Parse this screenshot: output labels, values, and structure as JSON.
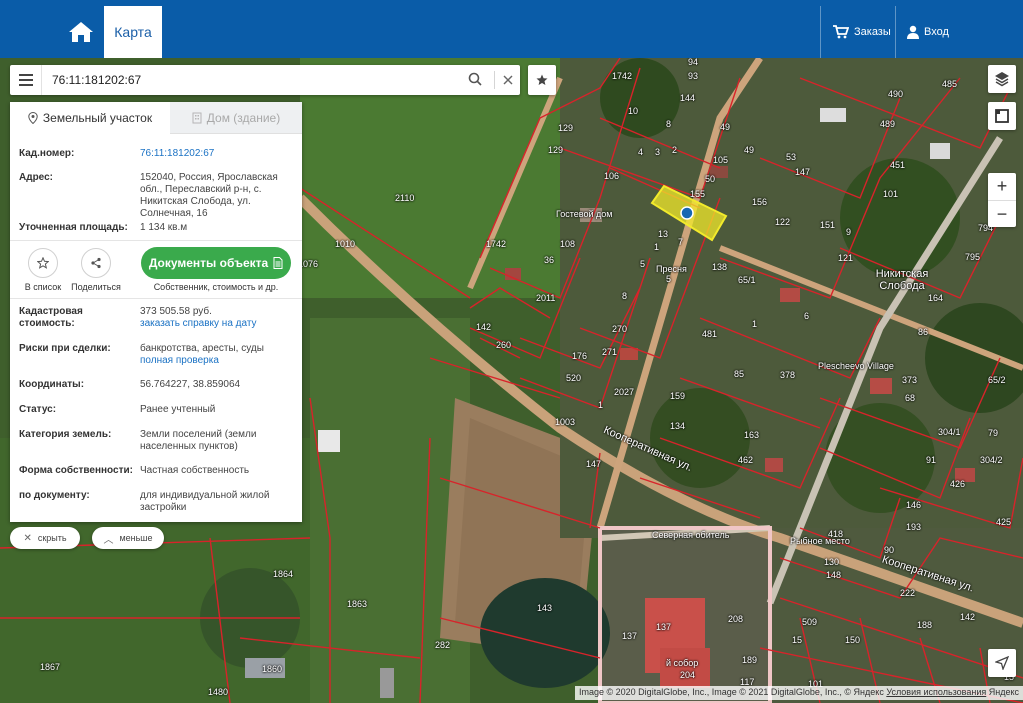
{
  "header": {
    "tab_map": "Карта",
    "orders": "Заказы",
    "login": "Вход"
  },
  "search": {
    "query": "76:11:181202:67"
  },
  "panel": {
    "tabs": [
      {
        "label": "Земельный участок",
        "active": true
      },
      {
        "label": "Дом (здание)",
        "active": false
      }
    ],
    "cadastral_label": "Кад.номер:",
    "cadastral_value": "76:11:181202:67",
    "address_label": "Адрес:",
    "address_value": "152040, Россия, Ярославская обл., Переславский р-н, с. Никитская Слобода, ул. Солнечная, 16",
    "area_label": "Уточненная площадь:",
    "area_value": "1 134 кв.м",
    "add_list": "В список",
    "share": "Поделиться",
    "docs_button": "Документы объекта",
    "docs_sub": "Собственник, стоимость и др.",
    "cost_label_1": "Кадастровая",
    "cost_label_2": "стоимость:",
    "cost_value": "373 505.58 руб.",
    "cost_link": "заказать справку на дату",
    "risks_label": "Риски при сделки:",
    "risks_value": "банкротства, аресты, суды",
    "risks_link": "полная проверка",
    "coords_label": "Координаты:",
    "coords_value": "56.764227, 38.859064",
    "status_label": "Статус:",
    "status_value": "Ранее учтенный",
    "category_label": "Категория земель:",
    "category_value": "Земли поселений (земли населенных пунктов)",
    "ownership_label": "Форма собственности:",
    "ownership_value": "Частная собственность",
    "doc_label": "по документу:",
    "doc_value": "для индивидуальной жилой застройки"
  },
  "pills": {
    "hide": "скрыть",
    "less": "меньше"
  },
  "map": {
    "copyright_1": "Image © 2020 DigitalGlobe, Inc., Image © 2021 DigitalGlobe, Inc., © Яндекс ",
    "copyright_terms": "Условия использования",
    "copyright_2": " Яндекс",
    "place_name": "Никитская Слобода",
    "street_1": "Кооперативная ул.",
    "street_2": "Кооперативная ул.",
    "poi_guest": "Гостевой дом",
    "poi_presnya": "Пресня",
    "poi_village": "Plescheevo Village",
    "poi_north": "Северная обитель",
    "poi_fishing": "Рыбное место",
    "poi_sobor": "й собор",
    "labels": [
      "94",
      "144",
      "1742",
      "93",
      "10",
      "8",
      "49",
      "53",
      "105",
      "50",
      "49",
      "155",
      "156",
      "147",
      "122",
      "101",
      "151",
      "489",
      "490",
      "485",
      "451",
      "2110",
      "1010",
      "129",
      "129",
      "106",
      "4",
      "3",
      "2",
      "13",
      "7",
      "1",
      "5",
      "36",
      "108",
      "5",
      "138",
      "65/1",
      "164",
      "794",
      "795",
      "121",
      "9",
      "1076",
      "1742",
      "2011",
      "142",
      "260",
      "8",
      "270",
      "481",
      "1",
      "6",
      "176",
      "271",
      "520",
      "2027",
      "1",
      "86",
      "373",
      "65/2",
      "1003",
      "147",
      "159",
      "134",
      "163",
      "378",
      "85",
      "462",
      "68",
      "79",
      "304/1",
      "91",
      "426",
      "304/2",
      "146",
      "193",
      "425",
      "418",
      "90",
      "130",
      "148",
      "222",
      "150",
      "509",
      "188",
      "1864",
      "1863",
      "1867",
      "1480",
      "1860",
      "282",
      "143",
      "137",
      "137",
      "208",
      "189",
      "15",
      "204",
      "101",
      "117",
      "142",
      "15"
    ],
    "label_colors": {
      "parcel_border": "#d8232a",
      "highlight": "#f2ea2b",
      "road": "#cda47c"
    }
  }
}
